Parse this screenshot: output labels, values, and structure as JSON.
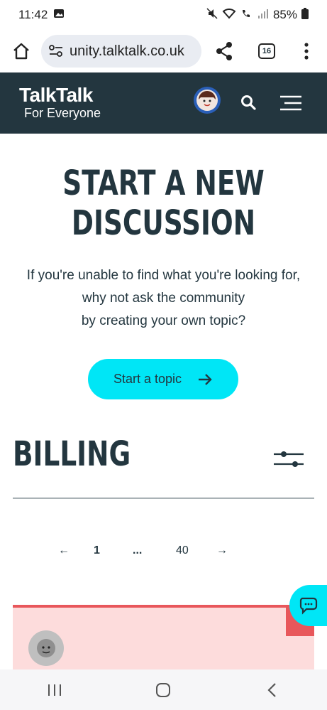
{
  "status": {
    "time": "11:42",
    "battery": "85%"
  },
  "browser": {
    "url": "unity.talktalk.co.uk",
    "tab_count": "16"
  },
  "header": {
    "logo_main": "TalkTalk",
    "logo_sub": "For Everyone"
  },
  "discussion": {
    "title_line1": "START A NEW",
    "title_line2": "DISCUSSION",
    "text_line1": "If you're unable to find what you're looking for,",
    "text_line2": "why not ask the community",
    "text_line3": "by creating your own topic?",
    "cta_label": "Start a topic"
  },
  "billing": {
    "title": "BILLING"
  },
  "pagination": {
    "prev": "←",
    "current": "1",
    "ellipsis": "...",
    "last": "40",
    "next": "→"
  },
  "colors": {
    "brand_dark": "#23363f",
    "accent_cyan": "#00e6f6",
    "card_red": "#e8575b",
    "card_bg": "#fddcdc"
  }
}
